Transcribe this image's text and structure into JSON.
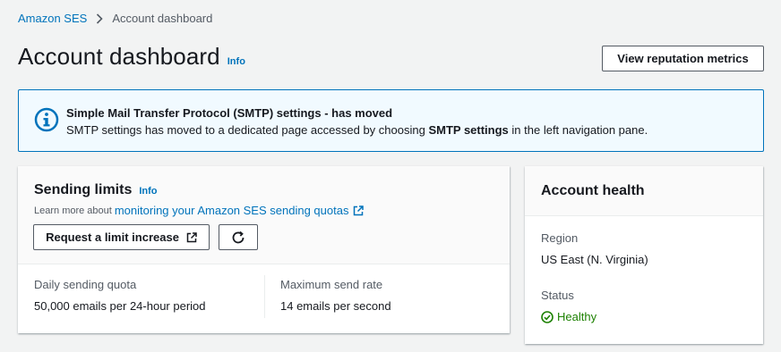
{
  "breadcrumb": {
    "root": "Amazon SES",
    "current": "Account dashboard"
  },
  "header": {
    "title": "Account dashboard",
    "info": "Info",
    "reputation_button": "View reputation metrics"
  },
  "flash": {
    "title": "Simple Mail Transfer Protocol (SMTP) settings - has moved",
    "body_prefix": "SMTP settings has moved to a dedicated page accessed by choosing ",
    "body_bold": "SMTP settings",
    "body_suffix": " in the left navigation pane."
  },
  "sending_limits": {
    "title": "Sending limits",
    "info": "Info",
    "learn_prefix": "Learn more about",
    "learn_link": "monitoring your Amazon SES sending quotas",
    "limit_button": "Request a limit increase",
    "daily_label": "Daily sending quota",
    "daily_value": "50,000 emails per 24-hour period",
    "rate_label": "Maximum send rate",
    "rate_value": "14 emails per second"
  },
  "account_health": {
    "title": "Account health",
    "region_label": "Region",
    "region_value": "US East (N. Virginia)",
    "status_label": "Status",
    "status_value": "Healthy"
  },
  "colors": {
    "link": "#0073bb",
    "success": "#1d8102",
    "info_bg": "#f1faff"
  }
}
